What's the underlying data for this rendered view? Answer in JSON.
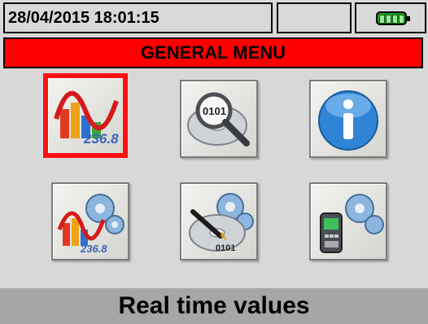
{
  "status_bar": {
    "datetime": "28/04/2015 18:01:15",
    "middle_box": "",
    "battery_icon": "battery-full-icon",
    "battery_level": 1.0
  },
  "header": {
    "title": "GENERAL MENU"
  },
  "menu_icons": [
    {
      "icon": "real-time-values-icon",
      "selected": true
    },
    {
      "icon": "data-recall-icon",
      "selected": false
    },
    {
      "icon": "info-icon",
      "selected": false
    },
    {
      "icon": "analyzer-settings-icon",
      "selected": false
    },
    {
      "icon": "recording-settings-icon",
      "selected": false
    },
    {
      "icon": "instrument-settings-icon",
      "selected": false
    }
  ],
  "icon_text": {
    "value_236": "236.8",
    "disc_0101_a": "0101",
    "disc_0101_b": "0101"
  },
  "footer": {
    "label": "Real time values"
  },
  "colors": {
    "title_bar": "#ff0000",
    "selection": "#ff1010",
    "footer_bg": "#a6a6a6"
  }
}
